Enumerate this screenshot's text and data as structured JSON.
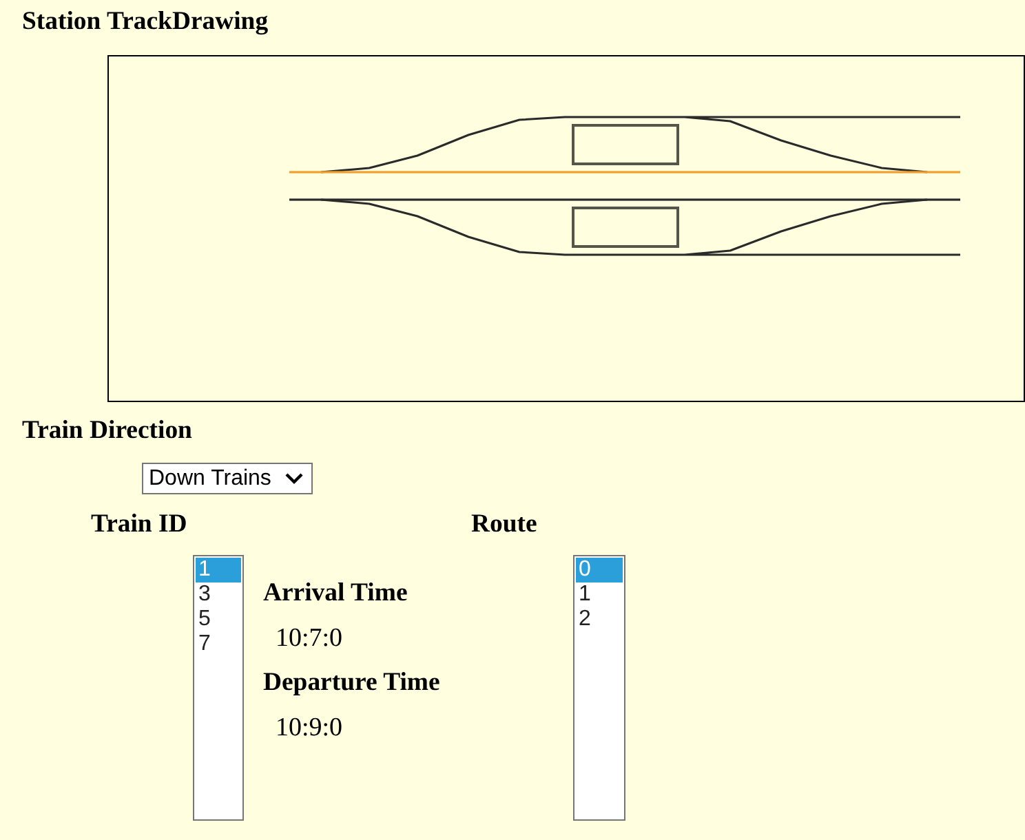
{
  "title": "Station TrackDrawing",
  "drawing": {
    "tracks": [
      {
        "kind": "main",
        "highlighted": true
      },
      {
        "kind": "main",
        "highlighted": false
      },
      {
        "kind": "loop",
        "highlighted": false
      },
      {
        "kind": "loop",
        "highlighted": false
      }
    ]
  },
  "direction": {
    "label": "Train Direction",
    "value": "Down Trains"
  },
  "train_list": {
    "label": "Train ID",
    "items": [
      {
        "label": "1",
        "selected": true
      },
      {
        "label": "3",
        "selected": false
      },
      {
        "label": "5",
        "selected": false
      },
      {
        "label": "7",
        "selected": false
      }
    ]
  },
  "times": [
    {
      "label": "Arrival Time",
      "value": "10:7:0"
    },
    {
      "label": "Departure Time",
      "value": "10:9:0"
    }
  ],
  "route_list": {
    "label": "Route",
    "items": [
      {
        "label": "0",
        "selected": true
      },
      {
        "label": "1",
        "selected": false
      },
      {
        "label": "2",
        "selected": false
      }
    ]
  }
}
